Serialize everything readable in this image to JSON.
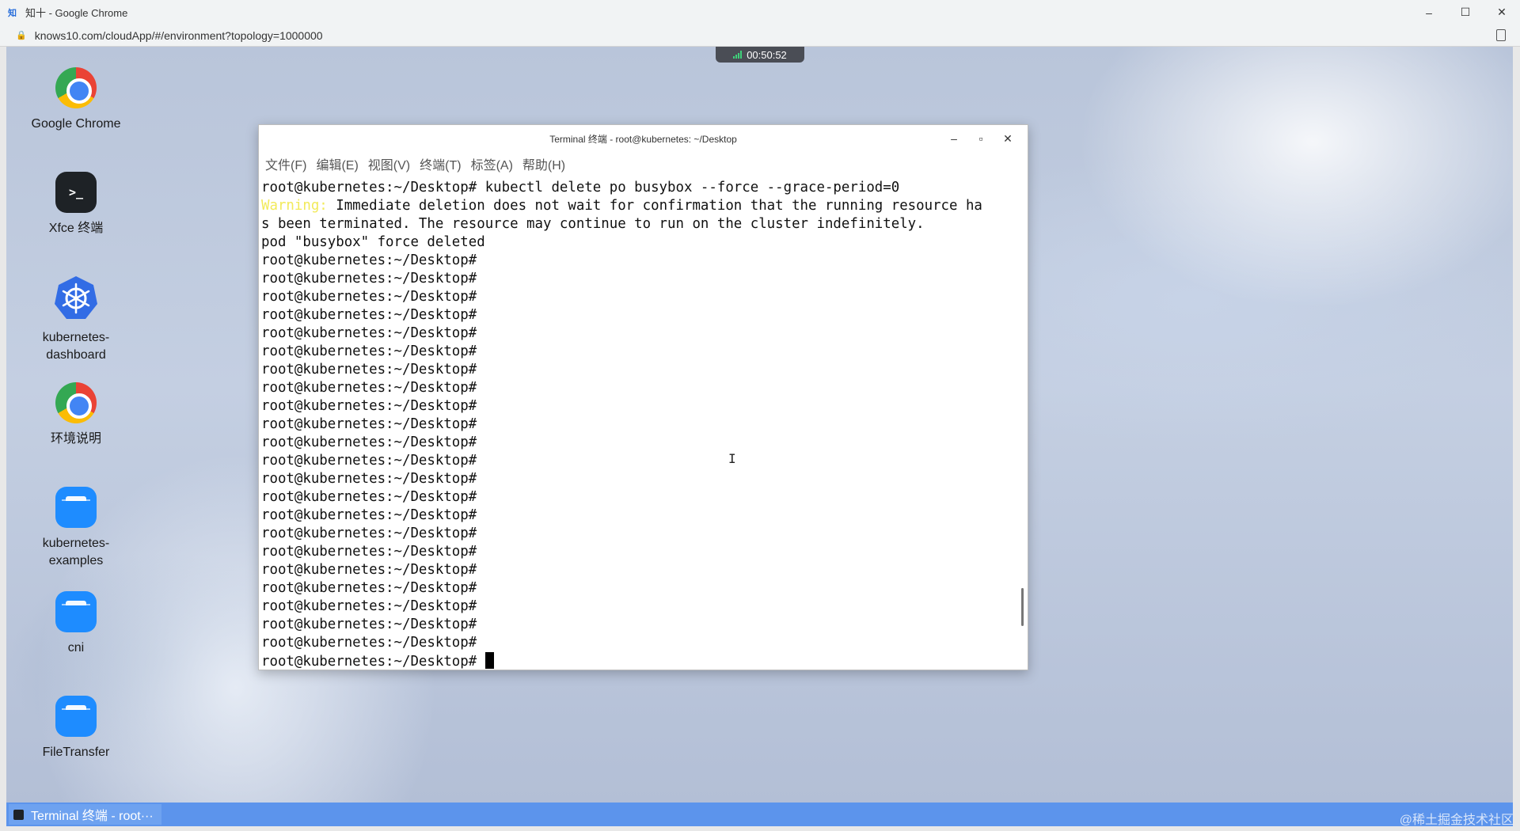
{
  "browser": {
    "window_title": "知十 - Google Chrome",
    "app_icon_text": "知",
    "url": "knows10.com/cloudApp/#/environment?topology=1000000",
    "controls": {
      "minimize": "–",
      "maximize": "☐",
      "close": "✕"
    }
  },
  "session": {
    "timer": "00:50:52"
  },
  "desktop_icons": [
    {
      "label": "Google Chrome",
      "icon": "chrome-icon"
    },
    {
      "label": "Xfce 终端",
      "icon": "terminal-icon",
      "glyph": ">_"
    },
    {
      "label": "kubernetes-dashboard",
      "icon": "kubernetes-icon"
    },
    {
      "label": "环境说明",
      "icon": "chrome-icon"
    },
    {
      "label": "kubernetes-examples",
      "icon": "folder-icon"
    },
    {
      "label": "cni",
      "icon": "folder-icon"
    },
    {
      "label": "FileTransfer",
      "icon": "folder-icon"
    }
  ],
  "terminal": {
    "title": "Terminal 终端 - root@kubernetes: ~/Desktop",
    "controls": {
      "minimize": "–",
      "maximize": "▫",
      "close": "✕"
    },
    "menu": [
      "文件(F)",
      "编辑(E)",
      "视图(V)",
      "终端(T)",
      "标签(A)",
      "帮助(H)"
    ],
    "command_line": "root@kubernetes:~/Desktop# kubectl delete po busybox --force --grace-period=0",
    "warning_label": "Warning:",
    "warning_text": " Immediate deletion does not wait for confirmation that the running resource ha",
    "warning_text_2": "s been terminated. The resource may continue to run on the cluster indefinitely.",
    "result_line": "pod \"busybox\" force deleted",
    "prompt": "root@kubernetes:~/Desktop#",
    "prompt_count": 23
  },
  "taskbar": {
    "task_label": "Terminal 终端 - root···",
    "watermark": "@稀土掘金技术社区"
  }
}
